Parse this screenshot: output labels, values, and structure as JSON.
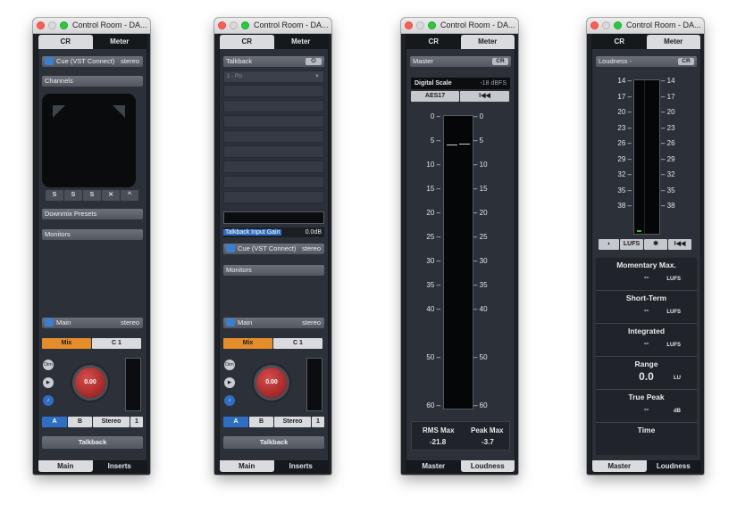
{
  "window_title": "Control Room - DA...",
  "tabs": {
    "cr": "CR",
    "meter": "Meter"
  },
  "bottom_tabs_main": {
    "main": "Main",
    "inserts": "Inserts"
  },
  "bottom_tabs_meter": {
    "master": "Master",
    "loudness": "Loudness"
  },
  "panel1": {
    "cue_label": "Cue (VST Connect)",
    "cue_format": "stereo",
    "channels": "Channels",
    "pad_buttons": [
      "S",
      "S",
      "S",
      "✕",
      "^"
    ],
    "downmix": "Downmix Presets",
    "monitors": "Monitors",
    "main_label": "Main",
    "main_format": "stereo",
    "mix": "Mix",
    "c1": "C 1",
    "dim": "Dim",
    "knob_value": "0.00",
    "a": "A",
    "b": "B",
    "stereo": "Stereo",
    "one": "1",
    "talkback": "Talkback"
  },
  "panel2": {
    "talkback_label": "Talkback",
    "dropdown": "1 - Pts",
    "tb_gain_label": "Talkback Input Gain",
    "tb_gain_value": "0.0dB",
    "cue_label": "Cue (VST Connect)",
    "cue_format": "stereo",
    "monitors": "Monitors",
    "main_label": "Main",
    "main_format": "stereo",
    "mix": "Mix",
    "c1": "C 1",
    "dim": "Dim",
    "knob_value": "0.00",
    "a": "A",
    "b": "B",
    "stereo": "Stereo",
    "one": "1",
    "talkback": "Talkback"
  },
  "panel3": {
    "master": "Master",
    "cr": "CR",
    "digital_scale": "Digital Scale",
    "dbfs": "-18 dBFS",
    "aes": "AES17",
    "skip": "I◀◀",
    "scale": [
      "0",
      "5",
      "10",
      "15",
      "20",
      "25",
      "30",
      "35",
      "40",
      "50",
      "60"
    ],
    "rms_label": "RMS Max",
    "rms_value": "-21.8",
    "peak_label": "Peak Max",
    "peak_value": "-3.7"
  },
  "panel4": {
    "loudness": "Loudness -",
    "cr": "CR",
    "scale": [
      "14",
      "17",
      "20",
      "23",
      "26",
      "29",
      "32",
      "35",
      "38"
    ],
    "lufs": "LUFS",
    "skip": "I◀◀",
    "sections": [
      {
        "title": "Momentary Max.",
        "value": "--",
        "unit": "LUFS"
      },
      {
        "title": "Short-Term",
        "value": "--",
        "unit": "LUFS"
      },
      {
        "title": "Integrated",
        "value": "--",
        "unit": "LUFS"
      },
      {
        "title": "Range",
        "value": "0.0",
        "unit": "LU"
      },
      {
        "title": "True Peak",
        "value": "--",
        "unit": "dB"
      },
      {
        "title": "Time",
        "value": "",
        "unit": ""
      }
    ]
  },
  "colors": {
    "accent_orange": "#e58d2b",
    "button_blue": "#2f6fc3",
    "knob_red": "#b52626",
    "meter_green": "#28c43a"
  }
}
